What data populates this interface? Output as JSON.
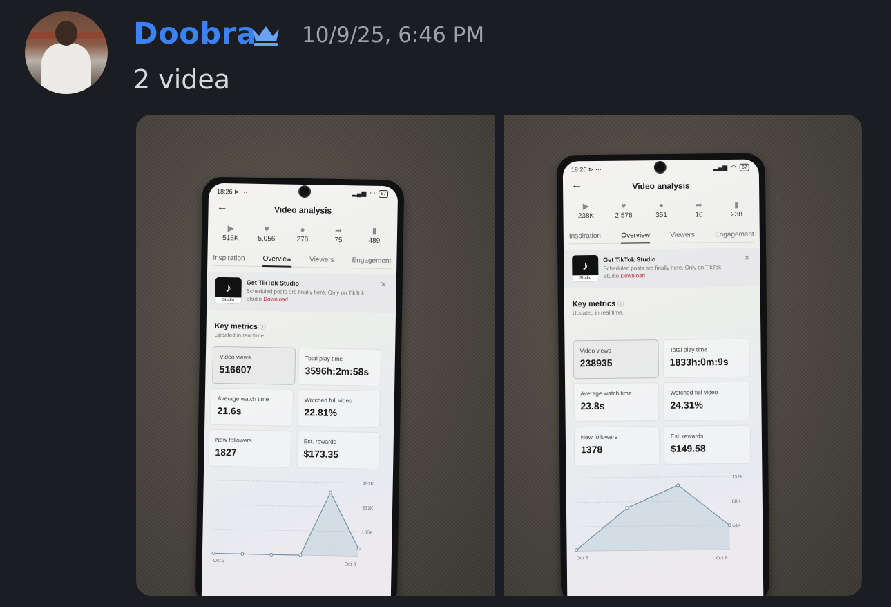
{
  "message": {
    "username": "Doobra",
    "timestamp": "10/9/25, 6:46 PM",
    "text": "2 videa",
    "username_color": "#3b82f6"
  },
  "photos": [
    {
      "status_time": "18:26",
      "status_extra": "⊳ ···",
      "battery": "67",
      "screen_title": "Video analysis",
      "stats": [
        {
          "icon": "play-icon",
          "value": "516K"
        },
        {
          "icon": "heart-icon",
          "value": "5,056"
        },
        {
          "icon": "comment-icon",
          "value": "278"
        },
        {
          "icon": "share-icon",
          "value": "75"
        },
        {
          "icon": "bookmark-icon",
          "value": "489"
        }
      ],
      "tabs": [
        "Inspiration",
        "Overview",
        "Viewers",
        "Engagement"
      ],
      "active_tab": "Overview",
      "promo": {
        "title": "Get TikTok Studio",
        "text": "Scheduled posts are finally here. Only on TikTok Studio",
        "link": "Download",
        "logo_label": "Studio"
      },
      "key_metrics_title": "Key metrics",
      "key_metrics_sub": "Updated in real time.",
      "metrics": [
        {
          "label": "Video views",
          "value": "516607"
        },
        {
          "label": "Total play time",
          "value": "3596h:2m:58s"
        },
        {
          "label": "Average watch time",
          "value": "21.6s"
        },
        {
          "label": "Watched full video",
          "value": "22.81%"
        },
        {
          "label": "New followers",
          "value": "1827"
        },
        {
          "label": "Est. rewards",
          "value": "$173.35"
        }
      ],
      "chart_data": {
        "type": "line",
        "x_start": "Oct 3",
        "x_end": "Oct 8",
        "y_ticks": [
          "497K",
          "331K",
          "165K"
        ],
        "ylim": [
          0,
          497000
        ],
        "values": [
          2000,
          1000,
          0,
          0,
          430000,
          50000
        ]
      }
    },
    {
      "status_time": "18:26",
      "status_extra": "⊳ ···",
      "battery": "67",
      "screen_title": "Video analysis",
      "stats": [
        {
          "icon": "play-icon",
          "value": "238K"
        },
        {
          "icon": "heart-icon",
          "value": "2,576"
        },
        {
          "icon": "comment-icon",
          "value": "351"
        },
        {
          "icon": "share-icon",
          "value": "16"
        },
        {
          "icon": "bookmark-icon",
          "value": "238"
        }
      ],
      "tabs": [
        "Inspiration",
        "Overview",
        "Viewers",
        "Engagement"
      ],
      "active_tab": "Overview",
      "promo": {
        "title": "Get TikTok Studio",
        "text": "Scheduled posts are finally here. Only on TikTok Studio",
        "link": "Download",
        "logo_label": "Studio"
      },
      "key_metrics_title": "Key metrics",
      "key_metrics_sub": "Updated in real time.",
      "metrics": [
        {
          "label": "Video views",
          "value": "238935"
        },
        {
          "label": "Total play time",
          "value": "1833h:0m:9s"
        },
        {
          "label": "Average watch time",
          "value": "23.8s"
        },
        {
          "label": "Watched full video",
          "value": "24.31%"
        },
        {
          "label": "New followers",
          "value": "1378"
        },
        {
          "label": "Est. rewards",
          "value": "$149.58"
        }
      ],
      "chart_data": {
        "type": "line",
        "x_start": "Oct 5",
        "x_end": "Oct 8",
        "y_ticks": [
          "132K",
          "88K",
          "44K"
        ],
        "ylim": [
          0,
          132000
        ],
        "values": [
          2000,
          77000,
          117000,
          44000
        ]
      }
    }
  ]
}
